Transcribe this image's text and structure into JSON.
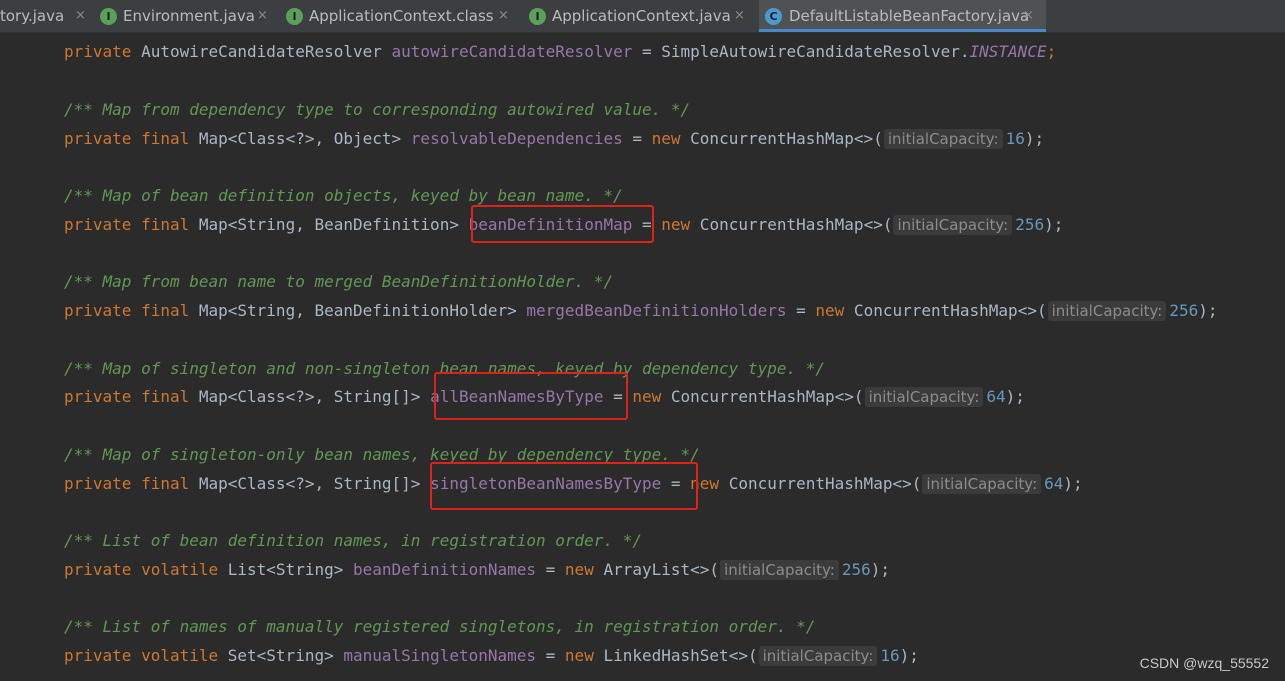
{
  "tabs": [
    {
      "label": "tory.java",
      "icon": "I",
      "icon_color": "#5aa05a",
      "active": false,
      "close": "×"
    },
    {
      "label": "Environment.java",
      "icon": "I",
      "icon_color": "#5aa05a",
      "active": false,
      "close": "×"
    },
    {
      "label": "ApplicationContext.class",
      "icon": "I",
      "icon_color": "#5aa05a",
      "active": false,
      "close": "×"
    },
    {
      "label": "ApplicationContext.java",
      "icon": "I",
      "icon_color": "#5aa05a",
      "active": false,
      "close": "×"
    },
    {
      "label": "DefaultListableBeanFactory.java",
      "icon": "C",
      "icon_color": "#4a9ad2",
      "active": true,
      "close": "×"
    }
  ],
  "code": {
    "l0": {
      "mod": "private",
      "type": " AutowireCandidateResolver ",
      "field": "autowireCandidateResolver",
      "eq": " = SimpleAutowireCandidateResolver.",
      "const": "INSTANCE",
      "end": ";"
    },
    "c1": "/** Map from dependency type to corresponding autowired value. */",
    "l1": {
      "mod": "private final",
      "type": " Map<Class<?>, Object> ",
      "field": "resolvableDependencies",
      "eq": " = ",
      "new": "new",
      "ctor": " ConcurrentHashMap<>(",
      "hint": "initialCapacity:",
      "num": "16",
      "end": ");"
    },
    "c2": "/** Map of bean definition objects, keyed by bean name. */",
    "l2": {
      "mod": "private final",
      "type": " Map<String, BeanDefinition> ",
      "field": "beanDefinitionMap",
      "eq": " = ",
      "new": "new",
      "ctor": " ConcurrentHashMap<>(",
      "hint": "initialCapacity:",
      "num": "256",
      "end": ");"
    },
    "c3": "/** Map from bean name to merged BeanDefinitionHolder. */",
    "l3": {
      "mod": "private final",
      "type": " Map<String, BeanDefinitionHolder> ",
      "field": "mergedBeanDefinitionHolders",
      "eq": " = ",
      "new": "new",
      "ctor": " ConcurrentHashMap<>(",
      "hint": "initialCapacity:",
      "num": "256",
      "end": ");"
    },
    "c4": "/** Map of singleton and non-singleton bean names, keyed by dependency type. */",
    "l4": {
      "mod": "private final",
      "type": " Map<Class<?>, String[]> ",
      "field": "allBeanNamesByType",
      "eq": " = ",
      "new": "new",
      "ctor": " ConcurrentHashMap<>(",
      "hint": "initialCapacity:",
      "num": "64",
      "end": ");"
    },
    "c5": "/** Map of singleton-only bean names, keyed by dependency type. */",
    "l5": {
      "mod": "private final",
      "type": " Map<Class<?>, String[]> ",
      "field": "singletonBeanNamesByType",
      "eq": " = ",
      "new": "new",
      "ctor": " ConcurrentHashMap<>(",
      "hint": "initialCapacity:",
      "num": "64",
      "end": ");"
    },
    "c6": "/** List of bean definition names, in registration order. */",
    "l6": {
      "mod": "private volatile",
      "type": " List<String> ",
      "field": "beanDefinitionNames",
      "eq": " = ",
      "new": "new",
      "ctor": " ArrayList<>(",
      "hint": "initialCapacity:",
      "num": "256",
      "end": ");"
    },
    "c7": "/** List of names of manually registered singletons, in registration order. */",
    "l7": {
      "mod": "private volatile",
      "type": " Set<String> ",
      "field": "manualSingletonNames",
      "eq": " = ",
      "new": "new",
      "ctor": " LinkedHashSet<>(",
      "hint": "initialCapacity:",
      "num": "16",
      "end": ");"
    }
  },
  "highlight_color": "#e0221b",
  "watermark": "CSDN @wzq_55552"
}
